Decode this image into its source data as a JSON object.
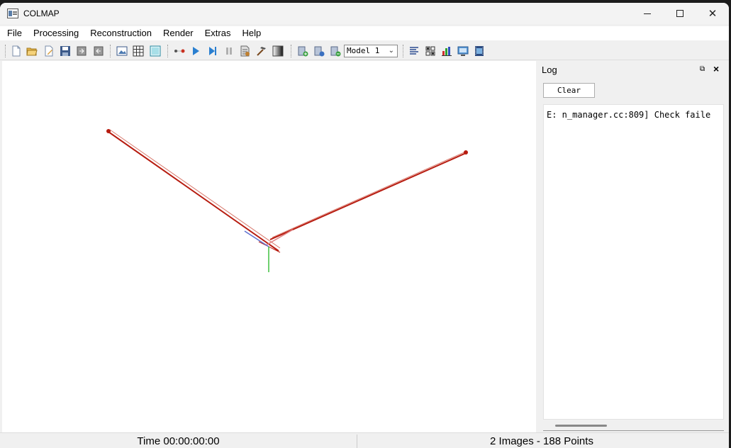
{
  "window": {
    "title": "COLMAP",
    "controls": {
      "minimize": "—",
      "maximize": "☐",
      "close": "✕"
    }
  },
  "menubar": {
    "items": [
      "File",
      "Processing",
      "Reconstruction",
      "Render",
      "Extras",
      "Help"
    ]
  },
  "toolbar": {
    "icons": [
      "new-project-icon",
      "open-project-icon",
      "edit-project-icon",
      "save-project-icon",
      "import-model-icon",
      "export-model-icon",
      "feature-extraction-icon",
      "feature-matching-icon",
      "database-management-icon",
      "start-reconstruction-icon",
      "play-icon",
      "step-icon",
      "pause-icon",
      "bundle-adjustment-icon",
      "dense-reconstruction-icon",
      "color-gradient-icon",
      "add-model-icon",
      "reset-model-icon",
      "delete-model-icon",
      "log-toggle-icon",
      "grid-icon",
      "statistics-icon",
      "screenshot-icon",
      "render-options-icon"
    ],
    "model_select": {
      "selected": "Model 1"
    }
  },
  "log": {
    "title": "Log",
    "clear_label": "Clear",
    "lines": [
      "E: n_manager.cc:809] Check faile"
    ]
  },
  "status": {
    "time": "Time 00:00:00:00",
    "counts": "2 Images - 188 Points"
  },
  "colors": {
    "camera_red": "#b71c10",
    "axis_blue": "#6070d0",
    "axis_green": "#40c040",
    "axis_red": "#e08080"
  }
}
